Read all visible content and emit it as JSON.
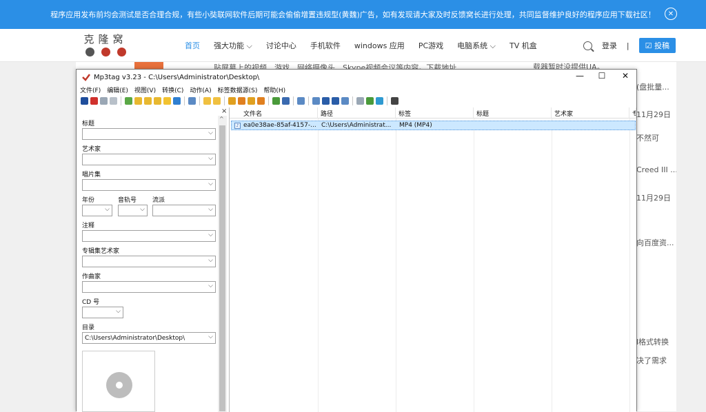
{
  "banner": {
    "text": "程序应用发布前均会测试是否合理合规，有些小奘联网软件后期可能会偷偷增置违规型(黄魏)广告，如有发现请大家及时反馈窝长进行处理，共同监督维护良好的程序应用下载社区！",
    "close": "✕"
  },
  "site": {
    "logo_text": "克隆窝",
    "nav": [
      "首页",
      "强大功能 ⌵",
      "讨论中心",
      "手机软件",
      "windows 应用",
      "PC游戏",
      "电脑系统 ⌵",
      "TV 机盒"
    ],
    "login": "登录",
    "login_sep": "|",
    "submit": "☑ 投稿",
    "behind_text": "贴屏幕上的视频、游戏、网络摄像头、Skype视频会议等内容。下载地址...",
    "behind_text2": "载器暂时没提供UA。",
    "right_col": [
      "(盘批量...",
      "11月29日",
      "不然可",
      "Creed III ...",
      "11月29日",
      "向百度资...",
      "l格式转换",
      "决了需求"
    ]
  },
  "app": {
    "title": "Mp3tag v3.23  -  C:\\Users\\Administrator\\Desktop\\",
    "controls": {
      "minimize": "—",
      "maximize": "☐",
      "close": "✕"
    },
    "menu": [
      "文件(F)",
      "编辑(E)",
      "视图(V)",
      "转换(C)",
      "动作(A)",
      "标签数据源(S)",
      "帮助(H)"
    ],
    "panel": {
      "close": "×",
      "fields": [
        {
          "label": "标题",
          "value": ""
        },
        {
          "label": "艺术家",
          "value": ""
        },
        {
          "label": "唱片集",
          "value": ""
        },
        {
          "label": "注释",
          "value": ""
        },
        {
          "label": "专辑集艺术家",
          "value": ""
        },
        {
          "label": "作曲家",
          "value": ""
        },
        {
          "label": "CD 号",
          "value": ""
        },
        {
          "label": "目录",
          "value": "C:\\Users\\Administrator\\Desktop\\"
        }
      ],
      "row_labels": {
        "year": "年份",
        "track": "音轨号",
        "genre": "流派"
      }
    },
    "list": {
      "columns": [
        "文件名",
        "路径",
        "标签",
        "标题",
        "艺术家",
        "专"
      ],
      "rows": [
        {
          "filename": "ea0e38ae-85af-4157-...",
          "path": "C:\\Users\\Administrat...",
          "tag": "MP4 (MP4)",
          "title": "",
          "artist": ""
        }
      ]
    }
  }
}
